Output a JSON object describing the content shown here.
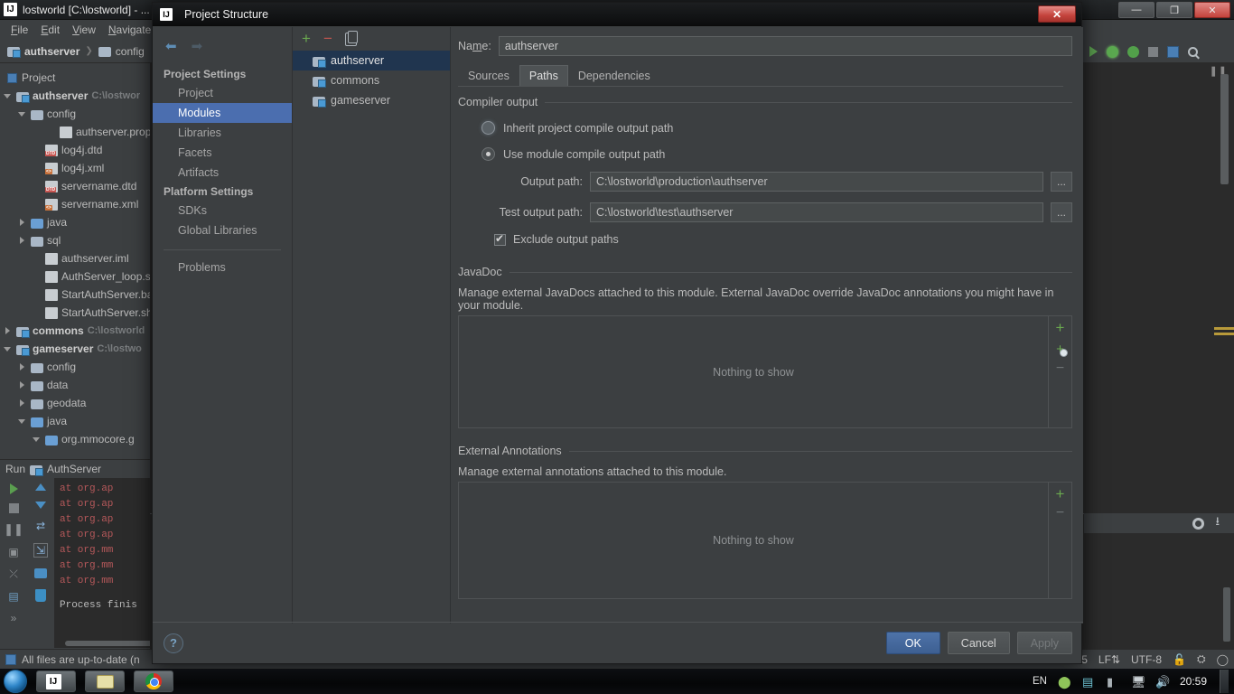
{
  "ide": {
    "title": "lostworld [C:\\lostworld] - ...",
    "logo_text": "IJ",
    "menu": [
      "File",
      "Edit",
      "View",
      "Navigate"
    ],
    "window_buttons": {
      "minimize": "—",
      "maximize": "❐",
      "close": "✕"
    },
    "breadcrumb": [
      "authserver",
      "config"
    ],
    "toolwindow_label": "Project",
    "tree": [
      {
        "depth": 0,
        "arrow": "expanded",
        "icon": "module-icon",
        "label": "authserver",
        "path": "C:\\lostwor",
        "bold": true
      },
      {
        "depth": 1,
        "arrow": "expanded",
        "icon": "folder-icon",
        "label": "config",
        "path": "",
        "bold": false
      },
      {
        "depth": 3,
        "arrow": "none",
        "icon": "properties-file-icon",
        "label": "authserver.prop",
        "path": "",
        "bold": false
      },
      {
        "depth": 2,
        "arrow": "none",
        "icon": "dtd-file-icon",
        "label": "log4j.dtd",
        "path": "",
        "bold": false
      },
      {
        "depth": 2,
        "arrow": "none",
        "icon": "xml-file-icon",
        "label": "log4j.xml",
        "path": "",
        "bold": false
      },
      {
        "depth": 2,
        "arrow": "none",
        "icon": "dtd-file-icon",
        "label": "servername.dtd",
        "path": "",
        "bold": false
      },
      {
        "depth": 2,
        "arrow": "none",
        "icon": "xml-file-icon",
        "label": "servername.xml",
        "path": "",
        "bold": false
      },
      {
        "depth": 1,
        "arrow": "collapsed",
        "icon": "source-folder-icon",
        "label": "java",
        "path": "",
        "bold": false
      },
      {
        "depth": 1,
        "arrow": "collapsed",
        "icon": "folder-icon",
        "label": "sql",
        "path": "",
        "bold": false
      },
      {
        "depth": 2,
        "arrow": "none",
        "icon": "iml-file-icon",
        "label": "authserver.iml",
        "path": "",
        "bold": false
      },
      {
        "depth": 2,
        "arrow": "none",
        "icon": "shell-file-icon",
        "label": "AuthServer_loop.sh",
        "path": "",
        "bold": false
      },
      {
        "depth": 2,
        "arrow": "none",
        "icon": "bat-file-icon",
        "label": "StartAuthServer.bat",
        "path": "",
        "bold": false
      },
      {
        "depth": 2,
        "arrow": "none",
        "icon": "shell-file-icon",
        "label": "StartAuthServer.sh",
        "path": "",
        "bold": false
      },
      {
        "depth": 0,
        "arrow": "collapsed",
        "icon": "module-icon",
        "label": "commons",
        "path": "C:\\lostworld",
        "bold": true
      },
      {
        "depth": 0,
        "arrow": "expanded",
        "icon": "module-icon",
        "label": "gameserver",
        "path": "C:\\lostwo",
        "bold": true
      },
      {
        "depth": 1,
        "arrow": "collapsed",
        "icon": "folder-icon",
        "label": "config",
        "path": "",
        "bold": false
      },
      {
        "depth": 1,
        "arrow": "collapsed",
        "icon": "folder-icon",
        "label": "data",
        "path": "",
        "bold": false
      },
      {
        "depth": 1,
        "arrow": "collapsed",
        "icon": "folder-icon",
        "label": "geodata",
        "path": "",
        "bold": false
      },
      {
        "depth": 1,
        "arrow": "expanded",
        "icon": "source-folder-icon",
        "label": "java",
        "path": "",
        "bold": false
      },
      {
        "depth": 2,
        "arrow": "expanded",
        "icon": "package-icon",
        "label": "org.mmocore.g",
        "path": "",
        "bold": false
      }
    ],
    "run_panel": {
      "title": "Run",
      "config_name": "AuthServer",
      "console_lines": [
        "at org.ap",
        "at org.ap",
        "at org.ap",
        "at org.ap",
        "at org.mm",
        "at org.mm",
        "at org.mm"
      ],
      "console_final": "Process finis"
    },
    "statusbar": {
      "message": "All files are up-to-date (n",
      "caret": "5",
      "line_separator": "LF",
      "encoding": "UTF-8"
    }
  },
  "dialog": {
    "title": "Project Structure",
    "logo_text": "IJ",
    "close_label": "✕",
    "nav": {
      "back_icon": "back-arrow-icon",
      "forward_icon": "forward-arrow-icon",
      "groups": [
        {
          "title": "Project Settings",
          "items": [
            "Project",
            "Modules",
            "Libraries",
            "Facets",
            "Artifacts"
          ]
        },
        {
          "title": "Platform Settings",
          "items": [
            "SDKs",
            "Global Libraries"
          ]
        }
      ],
      "selected": "Modules",
      "problems_label": "Problems"
    },
    "modules": {
      "toolbar": {
        "add": "+",
        "remove": "−",
        "copy": "copy-icon"
      },
      "items": [
        "authserver",
        "commons",
        "gameserver"
      ],
      "selected": "authserver"
    },
    "name_field": {
      "label": "Name:",
      "value": "authserver"
    },
    "tabs": {
      "items": [
        "Sources",
        "Paths",
        "Dependencies"
      ],
      "active": "Paths"
    },
    "compiler_output": {
      "section_title": "Compiler output",
      "inherit_label": "Inherit project compile output path",
      "use_module_label": "Use module compile output path",
      "selected": "Use module compile output path",
      "output_path_label": "Output path:",
      "output_path_value": "C:\\lostworld\\production\\authserver",
      "test_output_path_label": "Test output path:",
      "test_output_path_value": "C:\\lostworld\\test\\authserver",
      "browse_label": "...",
      "exclude_label": "Exclude output paths",
      "exclude_checked": true
    },
    "javadoc": {
      "section_title": "JavaDoc",
      "description": "Manage external JavaDocs attached to this module. External JavaDoc override JavaDoc annotations you might have in your module.",
      "empty_text": "Nothing to show",
      "actions": {
        "add": "+",
        "add_library": "+",
        "remove": "−"
      }
    },
    "external_annotations": {
      "section_title": "External Annotations",
      "description": "Manage external annotations attached to this module.",
      "empty_text": "Nothing to show",
      "actions": {
        "add": "+",
        "remove": "−"
      }
    },
    "footer": {
      "help_label": "?",
      "ok_label": "OK",
      "cancel_label": "Cancel",
      "apply_label": "Apply"
    }
  },
  "taskbar": {
    "start_label": "start-orb",
    "items": [
      "intellij-idea",
      "file-explorer",
      "google-chrome"
    ],
    "language": "EN",
    "clock": "20:59"
  },
  "colors": {
    "accent_blue": "#4b6eaf",
    "selection_blue": "#20354f",
    "panel_bg": "#3c3f41",
    "editor_bg": "#2b2b2b",
    "text": "#bbbbbb",
    "green": "#6aa84f",
    "red": "#c0554f",
    "error_text": "#b5585a"
  }
}
